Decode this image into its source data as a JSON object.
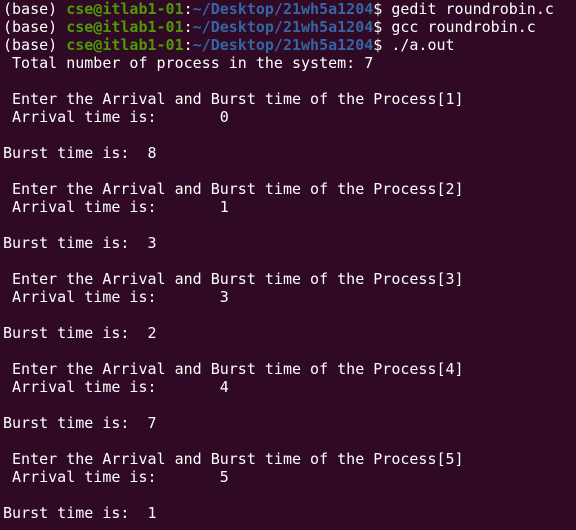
{
  "terminal": {
    "colors": {
      "background": "#300a24",
      "foreground": "#ffffff",
      "user_host": "#4e9a06",
      "path": "#3465a4"
    },
    "lines": [
      {
        "type": "prompt",
        "env": "(base) ",
        "userhost": "cse@itlab1-01",
        "sep": ":",
        "path": "~/Desktop/21wh5a1204",
        "symbol": "$ ",
        "command": "gedit roundrobin.c"
      },
      {
        "type": "prompt",
        "env": "(base) ",
        "userhost": "cse@itlab1-01",
        "sep": ":",
        "path": "~/Desktop/21wh5a1204",
        "symbol": "$ ",
        "command": "gcc roundrobin.c"
      },
      {
        "type": "prompt",
        "env": "(base) ",
        "userhost": "cse@itlab1-01",
        "sep": ":",
        "path": "~/Desktop/21wh5a1204",
        "symbol": "$ ",
        "command": "./a.out"
      },
      {
        "type": "output",
        "text": " Total number of process in the system: 7"
      },
      {
        "type": "output",
        "text": ""
      },
      {
        "type": "output",
        "text": " Enter the Arrival and Burst time of the Process[1]"
      },
      {
        "type": "output",
        "text": " Arrival time is:       0"
      },
      {
        "type": "output",
        "text": ""
      },
      {
        "type": "output",
        "text": "Burst time is:  8"
      },
      {
        "type": "output",
        "text": ""
      },
      {
        "type": "output",
        "text": " Enter the Arrival and Burst time of the Process[2]"
      },
      {
        "type": "output",
        "text": " Arrival time is:       1"
      },
      {
        "type": "output",
        "text": ""
      },
      {
        "type": "output",
        "text": "Burst time is:  3"
      },
      {
        "type": "output",
        "text": ""
      },
      {
        "type": "output",
        "text": " Enter the Arrival and Burst time of the Process[3]"
      },
      {
        "type": "output",
        "text": " Arrival time is:       3"
      },
      {
        "type": "output",
        "text": ""
      },
      {
        "type": "output",
        "text": "Burst time is:  2"
      },
      {
        "type": "output",
        "text": ""
      },
      {
        "type": "output",
        "text": " Enter the Arrival and Burst time of the Process[4]"
      },
      {
        "type": "output",
        "text": " Arrival time is:       4"
      },
      {
        "type": "output",
        "text": ""
      },
      {
        "type": "output",
        "text": "Burst time is:  7"
      },
      {
        "type": "output",
        "text": ""
      },
      {
        "type": "output",
        "text": " Enter the Arrival and Burst time of the Process[5]"
      },
      {
        "type": "output",
        "text": " Arrival time is:       5"
      },
      {
        "type": "output",
        "text": ""
      },
      {
        "type": "output",
        "text": "Burst time is:  1"
      }
    ]
  }
}
